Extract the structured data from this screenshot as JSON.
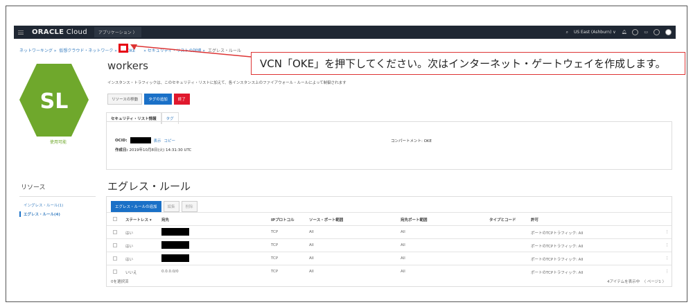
{
  "header": {
    "logo": "ORACLE",
    "logo_suffix": " Cloud",
    "apps": "アプリケーション 〉",
    "region": "US East (Ashburn) ∨"
  },
  "breadcrumb": [
    "ネットワーキング »",
    "仮想クラウド・ネットワーク »",
    "OKE",
    "» セキュリティ・リストの詳細 »",
    "エグレス・ルール"
  ],
  "callout": "VCN「OKE」を押下してください。次はインターネット・ゲートウェイを作成します。",
  "avatar": {
    "initials": "SL",
    "status": "使用可能",
    "color": "#6fa82c"
  },
  "page": {
    "title": "workers",
    "description": "インスタンス・トラフィックは、このセキュリティ・リストに加えて、各インスタンス上のファイアウォール・ルールによって制御されます"
  },
  "actions": {
    "move": "リソースの移動",
    "add_tags": "タグの追加",
    "terminate": "終了"
  },
  "tabs": [
    "セキュリティ・リスト情報",
    "タグ"
  ],
  "info": {
    "ocid_label": "OCID:",
    "show": "表示",
    "copy": "コピー",
    "created_label": "作成日:",
    "created": "2019年10月8日(火) 14:31:30 UTC",
    "compartment": "コンパートメント: OKE"
  },
  "sidebar": {
    "title": "リソース",
    "items": [
      "イングレス・ルール(1)",
      "エグレス・ルール(4)"
    ]
  },
  "section": {
    "title": "エグレス・ルール",
    "add": "エグレス・ルールの追加",
    "edit": "編集",
    "remove": "削除"
  },
  "table": {
    "columns": [
      "ステートレス ▾",
      "宛先",
      "IPプロトコル",
      "ソース・ポート範囲",
      "宛先ポート範囲",
      "タイプとコード",
      "許可"
    ],
    "rows": [
      {
        "stateless": "はい",
        "dest": "",
        "proto": "TCP",
        "src": "All",
        "dst": "All",
        "type": "",
        "allow": "ポートのTCPトラフィック: All"
      },
      {
        "stateless": "はい",
        "dest": "",
        "proto": "TCP",
        "src": "All",
        "dst": "All",
        "type": "",
        "allow": "ポートのTCPトラフィック: All"
      },
      {
        "stateless": "はい",
        "dest": "",
        "proto": "TCP",
        "src": "All",
        "dst": "All",
        "type": "",
        "allow": "ポートのTCPトラフィック: All"
      },
      {
        "stateless": "いいえ",
        "dest": "0.0.0.0/0",
        "proto": "TCP",
        "src": "All",
        "dst": "All",
        "type": "",
        "allow": "ポートのTCPトラフィック: All"
      }
    ],
    "selected": "0を選択済",
    "showing": "4アイテムを表示中",
    "page": "〈 ページ1 〉"
  }
}
